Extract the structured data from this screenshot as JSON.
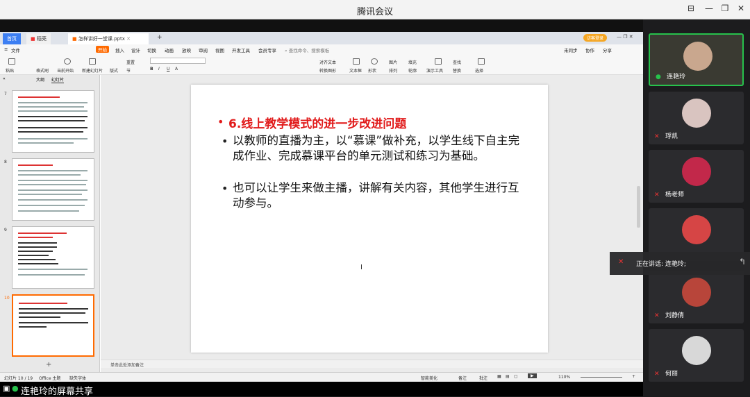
{
  "meeting": {
    "title": "腾讯会议",
    "share_label": "连艳玲的屏幕共享",
    "speaking_text": "正在讲话: 连艳玲;"
  },
  "wps": {
    "tabs": [
      {
        "label": "首页"
      },
      {
        "label": "稻壳"
      },
      {
        "label": "怎样讲好一堂课.pptx"
      }
    ],
    "login_label": "访客登录",
    "menu": [
      "文件",
      "开始",
      "插入",
      "设计",
      "切换",
      "动画",
      "放映",
      "审阅",
      "视图",
      "开发工具",
      "会员专享"
    ],
    "search_placeholder": "查找命令、搜索模板",
    "right_actions": [
      "未同步",
      "协作",
      "分享"
    ],
    "ribbon": [
      "粘贴",
      "格式刷",
      "当前开始",
      "新建幻灯片",
      "版式",
      "节",
      "重置",
      "文本框",
      "形状",
      "排列",
      "轮廓",
      "演示工具",
      "替换",
      "选择",
      "图片",
      "填充",
      "查找",
      "对齐文本",
      "转换图形"
    ],
    "pane_tabs": [
      "大纲",
      "幻灯片"
    ],
    "thumbs": [
      {
        "num": "7"
      },
      {
        "num": "8"
      },
      {
        "num": "9"
      },
      {
        "num": "10"
      }
    ],
    "notes_placeholder": "单击此处添加备注",
    "status": {
      "slide_pos": "幻灯片 10 / 19",
      "theme": "Office 主题",
      "missing_font": "缺失字体",
      "beautify": "智能美化",
      "notes": "备注",
      "comments": "批注",
      "zoom": "110%"
    }
  },
  "slide": {
    "title": "6.线上教学模式的进一步改进问题",
    "bullet1": "以教师的直播为主，以“慕课”做补充，以学生线下自主完成作业、完成慕课平台的单元测试和练习为基础。",
    "bullet2": "也可以让学生来做主播，讲解有关内容，其他学生进行互动参与。"
  },
  "participants": [
    {
      "name": "连艳玲",
      "active": true
    },
    {
      "name": "琈凯"
    },
    {
      "name": "杨老师"
    },
    {
      "name": ""
    },
    {
      "name": "刘静倩"
    },
    {
      "name": "何丽"
    }
  ],
  "colors": {
    "accent_red": "#e11b1b",
    "active_green": "#27c24c",
    "wps_orange": "#ff6a00"
  }
}
